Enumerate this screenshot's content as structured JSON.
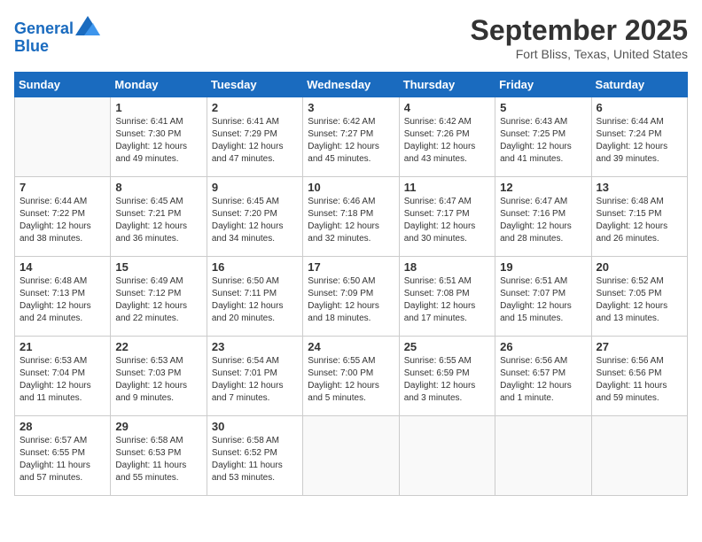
{
  "header": {
    "logo_line1": "General",
    "logo_line2": "Blue",
    "month": "September 2025",
    "location": "Fort Bliss, Texas, United States"
  },
  "weekdays": [
    "Sunday",
    "Monday",
    "Tuesday",
    "Wednesday",
    "Thursday",
    "Friday",
    "Saturday"
  ],
  "weeks": [
    [
      {
        "day": "",
        "info": ""
      },
      {
        "day": "1",
        "info": "Sunrise: 6:41 AM\nSunset: 7:30 PM\nDaylight: 12 hours\nand 49 minutes."
      },
      {
        "day": "2",
        "info": "Sunrise: 6:41 AM\nSunset: 7:29 PM\nDaylight: 12 hours\nand 47 minutes."
      },
      {
        "day": "3",
        "info": "Sunrise: 6:42 AM\nSunset: 7:27 PM\nDaylight: 12 hours\nand 45 minutes."
      },
      {
        "day": "4",
        "info": "Sunrise: 6:42 AM\nSunset: 7:26 PM\nDaylight: 12 hours\nand 43 minutes."
      },
      {
        "day": "5",
        "info": "Sunrise: 6:43 AM\nSunset: 7:25 PM\nDaylight: 12 hours\nand 41 minutes."
      },
      {
        "day": "6",
        "info": "Sunrise: 6:44 AM\nSunset: 7:24 PM\nDaylight: 12 hours\nand 39 minutes."
      }
    ],
    [
      {
        "day": "7",
        "info": "Sunrise: 6:44 AM\nSunset: 7:22 PM\nDaylight: 12 hours\nand 38 minutes."
      },
      {
        "day": "8",
        "info": "Sunrise: 6:45 AM\nSunset: 7:21 PM\nDaylight: 12 hours\nand 36 minutes."
      },
      {
        "day": "9",
        "info": "Sunrise: 6:45 AM\nSunset: 7:20 PM\nDaylight: 12 hours\nand 34 minutes."
      },
      {
        "day": "10",
        "info": "Sunrise: 6:46 AM\nSunset: 7:18 PM\nDaylight: 12 hours\nand 32 minutes."
      },
      {
        "day": "11",
        "info": "Sunrise: 6:47 AM\nSunset: 7:17 PM\nDaylight: 12 hours\nand 30 minutes."
      },
      {
        "day": "12",
        "info": "Sunrise: 6:47 AM\nSunset: 7:16 PM\nDaylight: 12 hours\nand 28 minutes."
      },
      {
        "day": "13",
        "info": "Sunrise: 6:48 AM\nSunset: 7:15 PM\nDaylight: 12 hours\nand 26 minutes."
      }
    ],
    [
      {
        "day": "14",
        "info": "Sunrise: 6:48 AM\nSunset: 7:13 PM\nDaylight: 12 hours\nand 24 minutes."
      },
      {
        "day": "15",
        "info": "Sunrise: 6:49 AM\nSunset: 7:12 PM\nDaylight: 12 hours\nand 22 minutes."
      },
      {
        "day": "16",
        "info": "Sunrise: 6:50 AM\nSunset: 7:11 PM\nDaylight: 12 hours\nand 20 minutes."
      },
      {
        "day": "17",
        "info": "Sunrise: 6:50 AM\nSunset: 7:09 PM\nDaylight: 12 hours\nand 18 minutes."
      },
      {
        "day": "18",
        "info": "Sunrise: 6:51 AM\nSunset: 7:08 PM\nDaylight: 12 hours\nand 17 minutes."
      },
      {
        "day": "19",
        "info": "Sunrise: 6:51 AM\nSunset: 7:07 PM\nDaylight: 12 hours\nand 15 minutes."
      },
      {
        "day": "20",
        "info": "Sunrise: 6:52 AM\nSunset: 7:05 PM\nDaylight: 12 hours\nand 13 minutes."
      }
    ],
    [
      {
        "day": "21",
        "info": "Sunrise: 6:53 AM\nSunset: 7:04 PM\nDaylight: 12 hours\nand 11 minutes."
      },
      {
        "day": "22",
        "info": "Sunrise: 6:53 AM\nSunset: 7:03 PM\nDaylight: 12 hours\nand 9 minutes."
      },
      {
        "day": "23",
        "info": "Sunrise: 6:54 AM\nSunset: 7:01 PM\nDaylight: 12 hours\nand 7 minutes."
      },
      {
        "day": "24",
        "info": "Sunrise: 6:55 AM\nSunset: 7:00 PM\nDaylight: 12 hours\nand 5 minutes."
      },
      {
        "day": "25",
        "info": "Sunrise: 6:55 AM\nSunset: 6:59 PM\nDaylight: 12 hours\nand 3 minutes."
      },
      {
        "day": "26",
        "info": "Sunrise: 6:56 AM\nSunset: 6:57 PM\nDaylight: 12 hours\nand 1 minute."
      },
      {
        "day": "27",
        "info": "Sunrise: 6:56 AM\nSunset: 6:56 PM\nDaylight: 11 hours\nand 59 minutes."
      }
    ],
    [
      {
        "day": "28",
        "info": "Sunrise: 6:57 AM\nSunset: 6:55 PM\nDaylight: 11 hours\nand 57 minutes."
      },
      {
        "day": "29",
        "info": "Sunrise: 6:58 AM\nSunset: 6:53 PM\nDaylight: 11 hours\nand 55 minutes."
      },
      {
        "day": "30",
        "info": "Sunrise: 6:58 AM\nSunset: 6:52 PM\nDaylight: 11 hours\nand 53 minutes."
      },
      {
        "day": "",
        "info": ""
      },
      {
        "day": "",
        "info": ""
      },
      {
        "day": "",
        "info": ""
      },
      {
        "day": "",
        "info": ""
      }
    ]
  ]
}
